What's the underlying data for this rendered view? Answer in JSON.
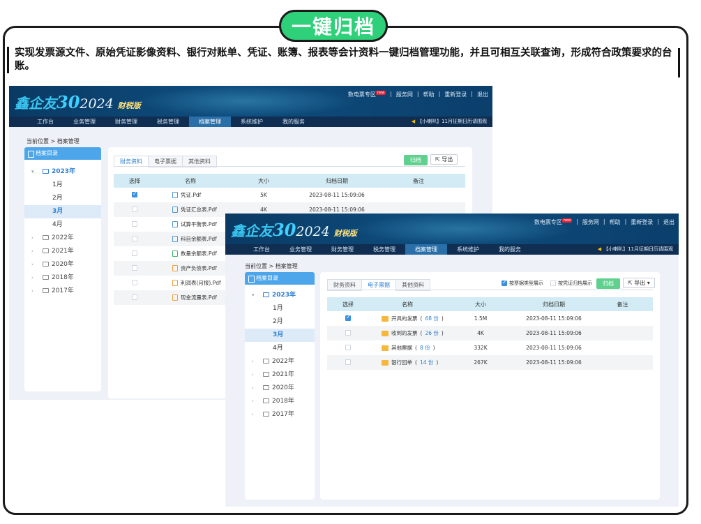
{
  "badge": "一键归档",
  "description": "实现发票源文件、原始凭证影像资料、银行对账单、凭证、账簿、报表等会计资料一键归档管理功能，并且可相互关联查询，形成符合政策要求的台账。",
  "app": {
    "logo_main": "鑫企友",
    "logo_num": "30",
    "logo_year": "2024",
    "logo_edition": "财税版",
    "top_links": [
      "数电票专区",
      "服务网",
      "帮助",
      "重新登录",
      "退出"
    ],
    "hot_tag": "new",
    "nav": [
      "工作台",
      "业务管理",
      "财务管理",
      "税务管理",
      "档案管理",
      "系统维护",
      "我的服务"
    ],
    "notice": "【小喇叭】11月征期日历请围观",
    "breadcrumb": "当前位置 > 档案管理",
    "sidebar_title": "档案目录",
    "open_year": "2023年",
    "months": [
      "1月",
      "2月",
      "3月",
      "4月"
    ],
    "years": [
      "2022年",
      "2021年",
      "2020年",
      "2018年",
      "2017年"
    ]
  },
  "window1": {
    "tabs": [
      "财务资料",
      "电子票据",
      "其他资料"
    ],
    "btn_archive": "归档",
    "btn_export": "导出",
    "columns": [
      "选择",
      "名称",
      "大小",
      "归档日期",
      "备注"
    ],
    "rows": [
      {
        "name": "凭证.Pdf",
        "size": "5K",
        "date": "2023-08-11 15:09:06",
        "checked": true,
        "icon": "blue"
      },
      {
        "name": "凭证汇总表.Pdf",
        "size": "4K",
        "date": "2023-08-11 15:09:06",
        "checked": false,
        "icon": "blue"
      },
      {
        "name": "试算平衡表.Pdf",
        "size": "",
        "date": "",
        "checked": false,
        "icon": "blue"
      },
      {
        "name": "科目余额表.Pdf",
        "size": "",
        "date": "",
        "checked": false,
        "icon": "blue"
      },
      {
        "name": "数量余额表.Pdf",
        "size": "",
        "date": "",
        "checked": false,
        "icon": "green"
      },
      {
        "name": "资产负债表.Pdf",
        "size": "",
        "date": "",
        "checked": false,
        "icon": "orange"
      },
      {
        "name": "利润表(月报).Pdf",
        "size": "",
        "date": "",
        "checked": false,
        "icon": "orange"
      },
      {
        "name": "现金流量表.Pdf",
        "size": "",
        "date": "",
        "checked": false,
        "icon": "orange"
      }
    ]
  },
  "window2": {
    "tabs": [
      "财务资料",
      "电子票据",
      "其他资料"
    ],
    "opt1": "按票据类型展示",
    "opt2": "按凭证归档展示",
    "btn_archive": "归档",
    "btn_export": "导出",
    "columns": [
      "选择",
      "名称",
      "大小",
      "归档日期",
      "备注"
    ],
    "rows": [
      {
        "name": "开具的发票",
        "count": "68 份",
        "size": "1.5M",
        "date": "2023-08-11 15:09:06",
        "checked": true
      },
      {
        "name": "收到的发票",
        "count": "26 份",
        "size": "4K",
        "date": "2023-08-11 15:09:06",
        "checked": false
      },
      {
        "name": "其他票据",
        "count": "8 份",
        "size": "332K",
        "date": "2023-08-11 15:09:06",
        "checked": false
      },
      {
        "name": "银行回单",
        "count": "14 份",
        "size": "267K",
        "date": "2023-08-11 15:09:06",
        "checked": false
      }
    ]
  }
}
